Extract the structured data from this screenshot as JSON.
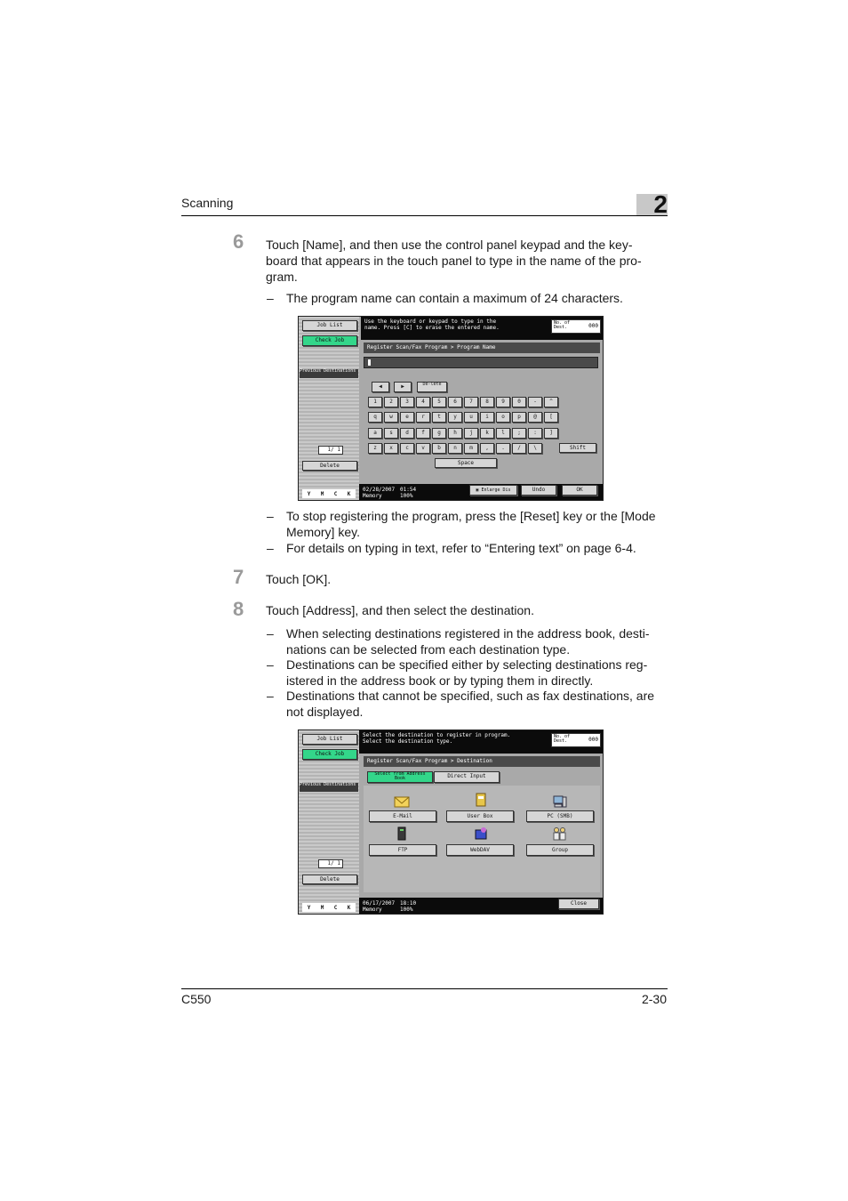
{
  "header": {
    "section_title": "Scanning",
    "chapter_number": "2"
  },
  "steps": [
    {
      "number": "6",
      "lines": [
        "Touch [Name], and then use the control panel keypad and the key-",
        "board that appears in the touch panel to type in the name of the pro-",
        "gram."
      ],
      "bullets_before": [
        "The program name can contain a maximum of 24 characters."
      ],
      "bullets_after": [
        [
          "To stop registering the program, press the [Reset] key or the [Mode",
          "Memory] key."
        ],
        [
          "For details on typing in text, refer to “Entering text” on page 6-4."
        ]
      ]
    },
    {
      "number": "7",
      "lines": [
        "Touch [OK]."
      ]
    },
    {
      "number": "8",
      "lines": [
        "Touch [Address], and then select the destination."
      ],
      "bullets_after": [
        [
          "When selecting destinations registered in the address book, desti-",
          "nations can be selected from each destination type."
        ],
        [
          "Destinations can be specified either by selecting destinations reg-",
          "istered in the address book or by typing them in directly."
        ],
        [
          "Destinations that cannot be specified, such as fax destinations, are",
          "not displayed."
        ]
      ]
    }
  ],
  "bullet_dash": "–",
  "screen1": {
    "job_list": "Job List",
    "check_job": "Check Job",
    "prev_dest": "Previous Destinations",
    "message": [
      "Use the keyboard or keypad to type in the",
      "name. Press [C] to erase the entered name."
    ],
    "counter_label": "No. of Dest.",
    "counter_value": "000",
    "breadcrumb": "Register Scan/Fax Program > Program Name",
    "page_counter": "1/ 1",
    "delete": "Delete",
    "del_key": "De-lete",
    "key_rows": [
      [
        "1",
        "2",
        "3",
        "4",
        "5",
        "6",
        "7",
        "8",
        "9",
        "0",
        "-",
        "^"
      ],
      [
        "q",
        "w",
        "e",
        "r",
        "t",
        "y",
        "u",
        "i",
        "o",
        "p",
        "@",
        "["
      ],
      [
        "a",
        "s",
        "d",
        "f",
        "g",
        "h",
        "j",
        "k",
        "l",
        ";",
        ":",
        "]"
      ],
      [
        "z",
        "x",
        "c",
        "v",
        "b",
        "n",
        "m",
        ",",
        ".",
        "/",
        "\\"
      ]
    ],
    "shift": "Shift",
    "space": "Space",
    "date": "02/28/2007",
    "time": "01:54",
    "memory_label": "Memory",
    "memory_value": "100%",
    "enlarge": "Enlarge Dis",
    "undo": "Undo",
    "ok": "OK",
    "cmyk": [
      "Y",
      "M",
      "C",
      "K"
    ]
  },
  "screen2": {
    "job_list": "Job List",
    "check_job": "Check Job",
    "prev_dest": "Previous Destinations",
    "message": [
      "Select the destination to register in program.",
      "Select the destination type."
    ],
    "counter_label": "No. of Dest.",
    "counter_value": "000",
    "breadcrumb": "Register Scan/Fax Program > Destination",
    "tab_address_book": "Select from Address Book",
    "tab_direct": "Direct Input",
    "types": [
      "E-Mail",
      "User Box",
      "PC (SMB)",
      "FTP",
      "WebDAV",
      "Group"
    ],
    "page_counter": "1/ 1",
    "delete": "Delete",
    "date": "06/17/2007",
    "time": "18:10",
    "memory_label": "Memory",
    "memory_value": "100%",
    "close": "Close",
    "cmyk": [
      "Y",
      "M",
      "C",
      "K"
    ]
  },
  "footer": {
    "model": "C550",
    "page": "2-30"
  }
}
